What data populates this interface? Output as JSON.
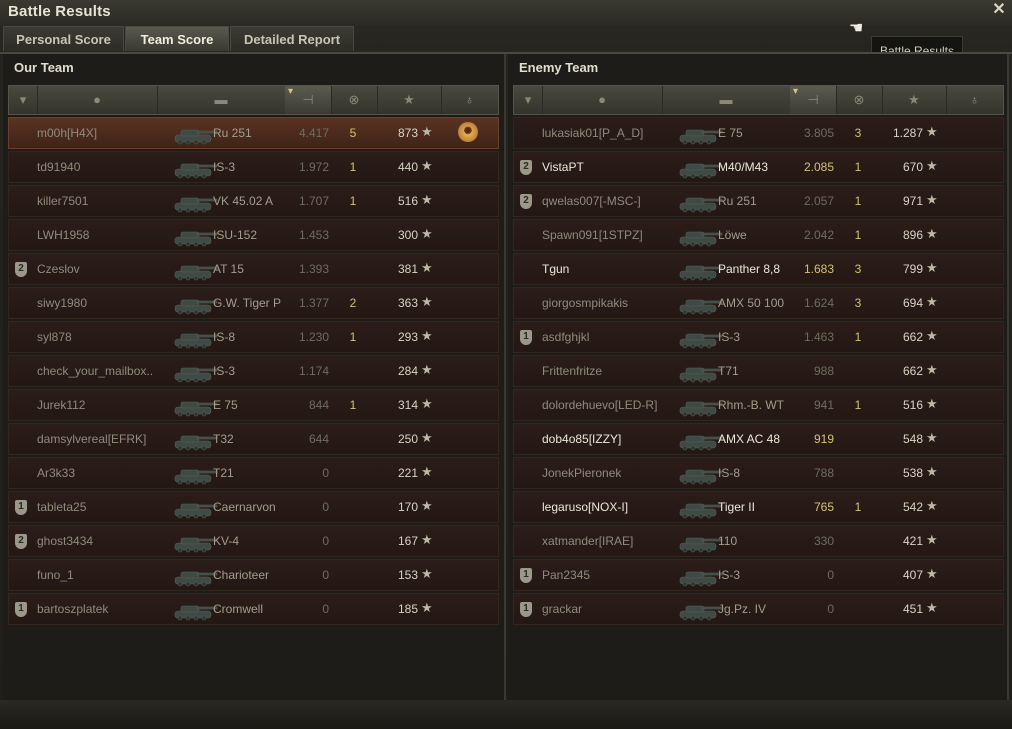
{
  "window": {
    "title": "Battle Results",
    "tooltip": "Battle Results"
  },
  "tabs": [
    {
      "label": "Personal Score"
    },
    {
      "label": "Team Score",
      "active": true
    },
    {
      "label": "Detailed Report"
    }
  ],
  "our_team": {
    "title": "Our Team",
    "rows": [
      {
        "player": "m00h[H4X]",
        "tank": "Ru 251",
        "rating": "4.417",
        "kills": "5",
        "xp": "873",
        "badge": "",
        "medal": true,
        "highlight": true
      },
      {
        "player": "td91940",
        "tank": "IS-3",
        "rating": "1.972",
        "kills": "1",
        "xp": "440",
        "badge": ""
      },
      {
        "player": "killer7501",
        "tank": "VK 45.02 A",
        "rating": "1.707",
        "kills": "1",
        "xp": "516",
        "badge": ""
      },
      {
        "player": "LWH1958",
        "tank": "ISU-152",
        "rating": "1.453",
        "kills": "",
        "xp": "300",
        "badge": ""
      },
      {
        "player": "Czeslov",
        "tank": "AT 15",
        "rating": "1.393",
        "kills": "",
        "xp": "381",
        "badge": "2"
      },
      {
        "player": "siwy1980",
        "tank": "G.W. Tiger P",
        "rating": "1.377",
        "kills": "2",
        "xp": "363",
        "badge": ""
      },
      {
        "player": "syl878",
        "tank": "IS-8",
        "rating": "1.230",
        "kills": "1",
        "xp": "293",
        "badge": ""
      },
      {
        "player": "check_your_mailbox..",
        "tank": "IS-3",
        "rating": "1.174",
        "kills": "",
        "xp": "284",
        "badge": ""
      },
      {
        "player": "Jurek112",
        "tank": "E 75",
        "rating": "844",
        "kills": "1",
        "xp": "314",
        "badge": ""
      },
      {
        "player": "damsylvereal[EFRK]",
        "tank": "T32",
        "rating": "644",
        "kills": "",
        "xp": "250",
        "badge": ""
      },
      {
        "player": "Ar3k33",
        "tank": "T21",
        "rating": "0",
        "kills": "",
        "xp": "221",
        "badge": ""
      },
      {
        "player": "tableta25",
        "tank": "Caernarvon",
        "rating": "0",
        "kills": "",
        "xp": "170",
        "badge": "1"
      },
      {
        "player": "ghost3434",
        "tank": "KV-4",
        "rating": "0",
        "kills": "",
        "xp": "167",
        "badge": "2"
      },
      {
        "player": "funo_1",
        "tank": "Charioteer",
        "rating": "0",
        "kills": "",
        "xp": "153",
        "badge": ""
      },
      {
        "player": "bartoszplatek",
        "tank": "Cromwell",
        "rating": "0",
        "kills": "",
        "xp": "185",
        "badge": "1"
      }
    ]
  },
  "enemy_team": {
    "title": "Enemy Team",
    "rows": [
      {
        "player": "lukasiak01[P_A_D]",
        "tank": "E 75",
        "rating": "3.805",
        "kills": "3",
        "xp": "1.287",
        "badge": ""
      },
      {
        "player": "VistaPT",
        "tank": "M40/M43",
        "rating": "2.085",
        "kills": "1",
        "xp": "670",
        "badge": "2",
        "bright": true
      },
      {
        "player": "qwelas007[-MSC-]",
        "tank": "Ru 251",
        "rating": "2.057",
        "kills": "1",
        "xp": "971",
        "badge": "2"
      },
      {
        "player": "Spawn091[1STPZ]",
        "tank": "Löwe",
        "rating": "2.042",
        "kills": "1",
        "xp": "896",
        "badge": ""
      },
      {
        "player": "Tgun",
        "tank": "Panther 8,8",
        "rating": "1.683",
        "kills": "3",
        "xp": "799",
        "badge": "",
        "bright": true
      },
      {
        "player": "giorgosmpikakis",
        "tank": "AMX 50 100",
        "rating": "1.624",
        "kills": "3",
        "xp": "694",
        "badge": ""
      },
      {
        "player": "asdfghjkl",
        "tank": "IS-3",
        "rating": "1.463",
        "kills": "1",
        "xp": "662",
        "badge": "1"
      },
      {
        "player": "Frittenfritze",
        "tank": "T71",
        "rating": "988",
        "kills": "",
        "xp": "662",
        "badge": ""
      },
      {
        "player": "dolordehuevo[LED-R]",
        "tank": "Rhm.-B. WT",
        "rating": "941",
        "kills": "1",
        "xp": "516",
        "badge": ""
      },
      {
        "player": "dob4o85[IZZY]",
        "tank": "AMX AC 48",
        "rating": "919",
        "kills": "",
        "xp": "548",
        "badge": "",
        "bright": true
      },
      {
        "player": "JonekPieronek",
        "tank": "IS-8",
        "rating": "788",
        "kills": "",
        "xp": "538",
        "badge": ""
      },
      {
        "player": "legaruso[NOX-I]",
        "tank": "Tiger II",
        "rating": "765",
        "kills": "1",
        "xp": "542",
        "badge": "",
        "bright": true
      },
      {
        "player": "xatmander[IRAE]",
        "tank": "110",
        "rating": "330",
        "kills": "",
        "xp": "421",
        "badge": ""
      },
      {
        "player": "Pan2345",
        "tank": "IS-3",
        "rating": "0",
        "kills": "",
        "xp": "407",
        "badge": "1"
      },
      {
        "player": "grackar",
        "tank": "Jg.Pz. IV",
        "rating": "0",
        "kills": "",
        "xp": "451",
        "badge": "1"
      }
    ]
  },
  "header_icons": [
    "badge-icon",
    "player-icon",
    "tank-icon",
    "damage-icon",
    "kills-icon",
    "xp-icon",
    "medal-icon"
  ],
  "colors": {
    "gold": "#d2c277",
    "highlight": "#5a3221"
  }
}
